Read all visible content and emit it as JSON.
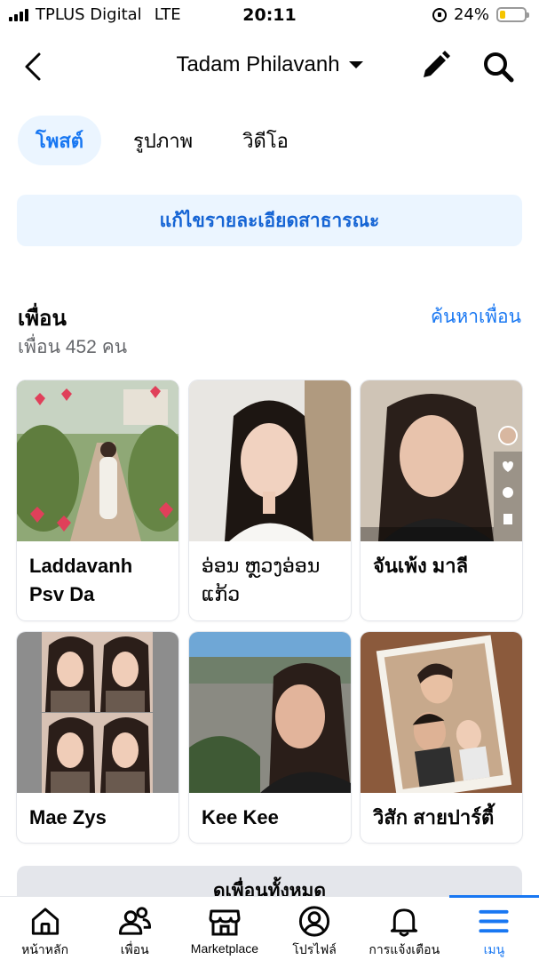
{
  "status_bar": {
    "carrier": "TPLUS Digital",
    "network": "LTE",
    "time": "20:11",
    "battery_percent": "24%",
    "battery_level": 0.24
  },
  "header": {
    "title": "Tadam Philavanh"
  },
  "tabs": [
    {
      "label": "โพสต์",
      "active": true
    },
    {
      "label": "รูปภาพ",
      "active": false
    },
    {
      "label": "วิดีโอ",
      "active": false
    }
  ],
  "edit_public_details": "แก้ไขรายละเอียดสาธารณะ",
  "friends": {
    "title": "เพื่อน",
    "find_link": "ค้นหาเพื่อน",
    "count_text": "เพื่อน 452 คน",
    "list": [
      {
        "name": "Laddavanh Psv Da"
      },
      {
        "name": "ອ່ອນ ຫຼວງອ່ອນ ແກ້ວ"
      },
      {
        "name": "จันเพ้ง มาลี"
      },
      {
        "name": "Mae Zys"
      },
      {
        "name": "Kee Kee"
      },
      {
        "name": "วิสัก สายปาร์ตี้"
      }
    ],
    "see_all": "ดูเพื่อนทั้งหมด"
  },
  "bottom_nav": [
    {
      "label": "หน้าหลัก",
      "icon": "home-icon",
      "active": false
    },
    {
      "label": "เพื่อน",
      "icon": "friends-icon",
      "active": false
    },
    {
      "label": "Marketplace",
      "icon": "marketplace-icon",
      "active": false
    },
    {
      "label": "โปรไฟล์",
      "icon": "profile-icon",
      "active": false
    },
    {
      "label": "การแจ้งเตือน",
      "icon": "bell-icon",
      "active": false
    },
    {
      "label": "เมนู",
      "icon": "menu-icon",
      "active": true
    }
  ],
  "colors": {
    "accent": "#1877f2",
    "tab_active_bg": "#ebf5ff"
  }
}
